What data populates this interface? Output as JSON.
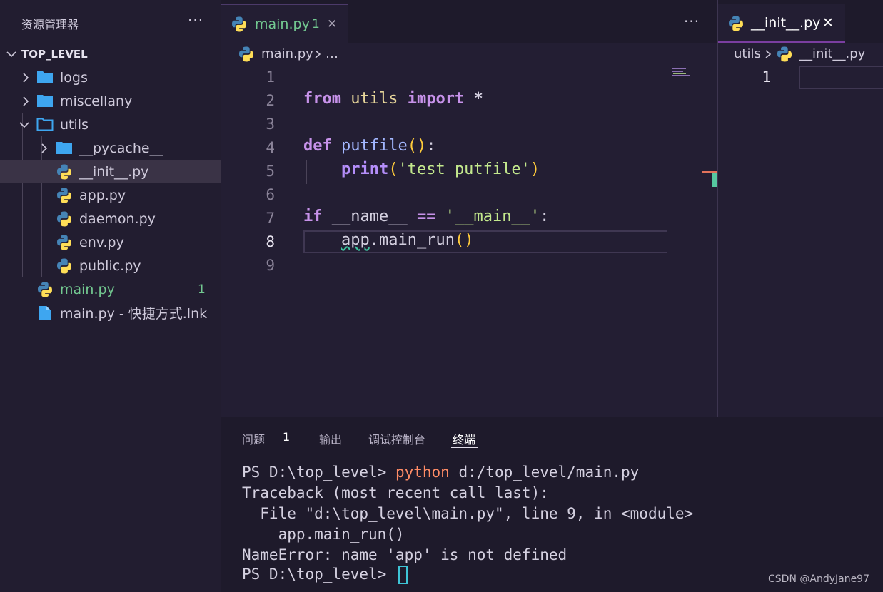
{
  "sidebar": {
    "title": "资源管理器",
    "more": "···",
    "root": "TOP_LEVEL",
    "items": [
      {
        "label": "logs",
        "type": "folder"
      },
      {
        "label": "miscellany",
        "type": "folder"
      },
      {
        "label": "utils",
        "type": "folder-open"
      },
      {
        "label": "__pycache__",
        "type": "folder"
      },
      {
        "label": "__init__.py",
        "type": "python"
      },
      {
        "label": "app.py",
        "type": "python"
      },
      {
        "label": "daemon.py",
        "type": "python"
      },
      {
        "label": "env.py",
        "type": "python"
      },
      {
        "label": "public.py",
        "type": "python"
      },
      {
        "label": "main.py",
        "type": "python",
        "badge": "1"
      },
      {
        "label": "main.py - 快捷方式.lnk",
        "type": "file"
      }
    ]
  },
  "editor1": {
    "tab": {
      "label": "main.py",
      "badge": "1",
      "close": "✕"
    },
    "more": "···",
    "breadcrumb": {
      "file": "main.py",
      "rest": "…"
    },
    "line_numbers": [
      "1",
      "2",
      "3",
      "4",
      "5",
      "6",
      "7",
      "8",
      "9"
    ],
    "current_line": "8",
    "code": {
      "l2": {
        "kw1": "from",
        "mod": "utils",
        "kw2": "import",
        "star": "*"
      },
      "l4": {
        "kw": "def",
        "name": "putfile",
        "open": "(",
        "close": ")",
        "colon": ":"
      },
      "l5": {
        "fn": "print",
        "open": "(",
        "str": "'test putfile'",
        "close": ")"
      },
      "l7": {
        "kw": "if",
        "name": "__name__",
        "op": "==",
        "str": "'__main__'",
        "colon": ":"
      },
      "l8": {
        "obj": "app",
        "dot": ".",
        "fn": "main_run",
        "open": "(",
        "close": ")"
      }
    }
  },
  "editor2": {
    "tab": {
      "label": "__init__.py",
      "close": "✕"
    },
    "breadcrumb": {
      "folder": "utils",
      "file": "__init__.py"
    },
    "line_numbers": [
      "1"
    ]
  },
  "panel": {
    "tabs": [
      {
        "label": "问题",
        "badge": "1"
      },
      {
        "label": "输出"
      },
      {
        "label": "调试控制台"
      },
      {
        "label": "终端",
        "active": true
      }
    ],
    "terminal": {
      "line1_prompt": "PS D:\\top_level> ",
      "line1_cmd": "python",
      "line1_args": " d:/top_level/main.py",
      "line2": "Traceback (most recent call last):",
      "line3": "  File \"d:\\top_level\\main.py\", line 9, in <module>",
      "line4": "    app.main_run()",
      "line5": "NameError: name 'app' is not defined",
      "line6_prompt": "PS D:\\top_level> "
    }
  },
  "watermark": "CSDN @AndyJane97",
  "colors": {
    "background": "#1e1a2b",
    "editor": "#231e33",
    "accent": "#4c3a6a",
    "modified": "#73c991"
  }
}
